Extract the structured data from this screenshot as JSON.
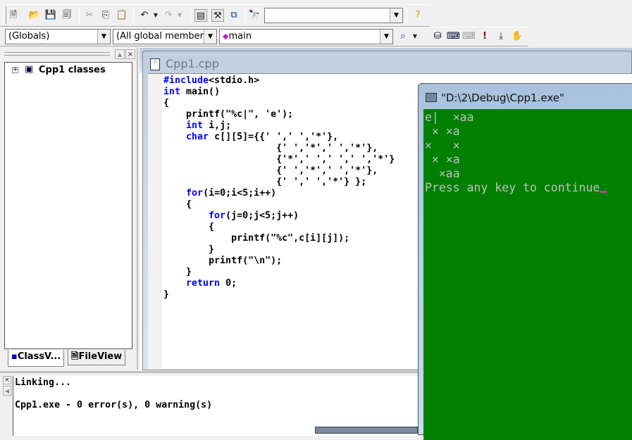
{
  "toolbar": {
    "icons": [
      "new-text-file-icon",
      "open-icon",
      "save-icon",
      "save-all-icon",
      "cut-icon",
      "copy-icon",
      "paste-icon",
      "undo-icon",
      "redo-icon",
      "workspace-icon",
      "output-icon",
      "window-list-icon",
      "find-in-files-icon",
      "search-help-icon"
    ],
    "find_value": ""
  },
  "wizardbar": {
    "class_combo": "(Globals)",
    "member_combo": "(All global member",
    "function_combo": "main"
  },
  "buildbar": {
    "icons": [
      "compile-icon",
      "build-icon",
      "stop-build-icon",
      "execute-icon",
      "go-icon",
      "insert-breakpoint-icon"
    ]
  },
  "workspace": {
    "tree_root": "Cpp1 classes",
    "tabs": [
      {
        "label": "ClassV..."
      },
      {
        "label": "FileView"
      }
    ]
  },
  "editor": {
    "title": "Cpp1.cpp",
    "lines": [
      [
        {
          "t": "#include",
          "k": 1
        },
        {
          "t": "<stdio.h>"
        }
      ],
      [
        {
          "t": "int",
          "k": 1
        },
        {
          "t": " main()"
        }
      ],
      [
        {
          "t": "{"
        }
      ],
      [
        {
          "t": "    printf(\"%c|\", 'e');"
        }
      ],
      [
        {
          "t": "    "
        },
        {
          "t": "int",
          "k": 1
        },
        {
          "t": " i,j;"
        }
      ],
      [
        {
          "t": "    "
        },
        {
          "t": "char",
          "k": 1
        },
        {
          "t": " c[][5]={{' ',' ','*'},"
        }
      ],
      [
        {
          "t": "                    {' ','*',' ','*'},"
        }
      ],
      [
        {
          "t": "                    {'*',' ',' ',' ','*'}"
        }
      ],
      [
        {
          "t": "                    {' ','*',' ','*'},"
        }
      ],
      [
        {
          "t": "                    {' ',' ','*'} };"
        }
      ],
      [
        {
          "t": "    "
        },
        {
          "t": "for",
          "k": 1
        },
        {
          "t": "(i=0;i<5;i++)"
        }
      ],
      [
        {
          "t": "    {"
        }
      ],
      [
        {
          "t": "        "
        },
        {
          "t": "for",
          "k": 1
        },
        {
          "t": "(j=0;j<5;j++)"
        }
      ],
      [
        {
          "t": "        {"
        }
      ],
      [
        {
          "t": "            printf(\"%c\",c[i][j]);"
        }
      ],
      [
        {
          "t": "        }"
        }
      ],
      [
        {
          "t": "        printf(\"\\n\");"
        }
      ],
      [
        {
          "t": "    }"
        }
      ],
      [
        {
          "t": "    "
        },
        {
          "t": "return",
          "k": 1
        },
        {
          "t": " 0;"
        }
      ],
      [
        {
          "t": "}"
        }
      ]
    ]
  },
  "console": {
    "title": "\"D:\\2\\Debug\\Cpp1.exe\"",
    "lines": [
      "e|  ×aa",
      " × ×a",
      "×   ×",
      " × ×a",
      "  ×aa",
      "Press any key to continue"
    ],
    "bg_color": "#008000",
    "cursor_color": "#c040c0"
  },
  "output": {
    "lines": [
      "Linking...",
      "",
      "Cpp1.exe - 0 error(s), 0 warning(s)"
    ]
  },
  "colors": {
    "keyword": "#0000ff"
  }
}
